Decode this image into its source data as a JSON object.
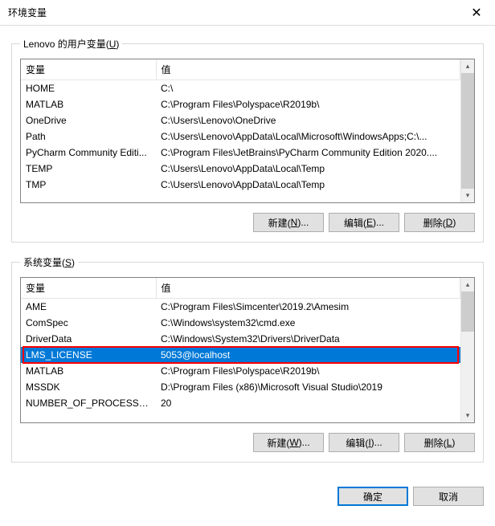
{
  "window": {
    "title": "环境变量"
  },
  "user_section": {
    "legend": "Lenovo 的用户变量(U)",
    "legend_key": "U",
    "columns": {
      "name": "变量",
      "value": "值"
    },
    "rows": [
      {
        "name": "HOME",
        "value": "C:\\"
      },
      {
        "name": "MATLAB",
        "value": "C:\\Program Files\\Polyspace\\R2019b\\"
      },
      {
        "name": "OneDrive",
        "value": "C:\\Users\\Lenovo\\OneDrive"
      },
      {
        "name": "Path",
        "value": "C:\\Users\\Lenovo\\AppData\\Local\\Microsoft\\WindowsApps;C:\\..."
      },
      {
        "name": "PyCharm Community Editi...",
        "value": "C:\\Program Files\\JetBrains\\PyCharm Community Edition 2020...."
      },
      {
        "name": "TEMP",
        "value": "C:\\Users\\Lenovo\\AppData\\Local\\Temp"
      },
      {
        "name": "TMP",
        "value": "C:\\Users\\Lenovo\\AppData\\Local\\Temp"
      }
    ],
    "buttons": {
      "new": {
        "text": "新建(N)...",
        "key": "N"
      },
      "edit": {
        "text": "编辑(E)...",
        "key": "E"
      },
      "delete": {
        "text": "删除(D)",
        "key": "D"
      }
    }
  },
  "system_section": {
    "legend": "系统变量(S)",
    "legend_key": "S",
    "columns": {
      "name": "变量",
      "value": "值"
    },
    "rows": [
      {
        "name": "AME",
        "value": "C:\\Program Files\\Simcenter\\2019.2\\Amesim",
        "selected": false
      },
      {
        "name": "ComSpec",
        "value": "C:\\Windows\\system32\\cmd.exe",
        "selected": false
      },
      {
        "name": "DriverData",
        "value": "C:\\Windows\\System32\\Drivers\\DriverData",
        "selected": false
      },
      {
        "name": "LMS_LICENSE",
        "value": "5053@localhost",
        "selected": true
      },
      {
        "name": "MATLAB",
        "value": "C:\\Program Files\\Polyspace\\R2019b\\",
        "selected": false
      },
      {
        "name": "MSSDK",
        "value": "D:\\Program Files (x86)\\Microsoft Visual Studio\\2019",
        "selected": false
      },
      {
        "name": "NUMBER_OF_PROCESSORS",
        "value": "20",
        "selected": false
      }
    ],
    "buttons": {
      "new": {
        "text": "新建(W)...",
        "key": "W"
      },
      "edit": {
        "text": "编辑(I)...",
        "key": "I"
      },
      "delete": {
        "text": "删除(L)",
        "key": "L"
      }
    }
  },
  "footer": {
    "ok": "确定",
    "cancel": "取消"
  }
}
